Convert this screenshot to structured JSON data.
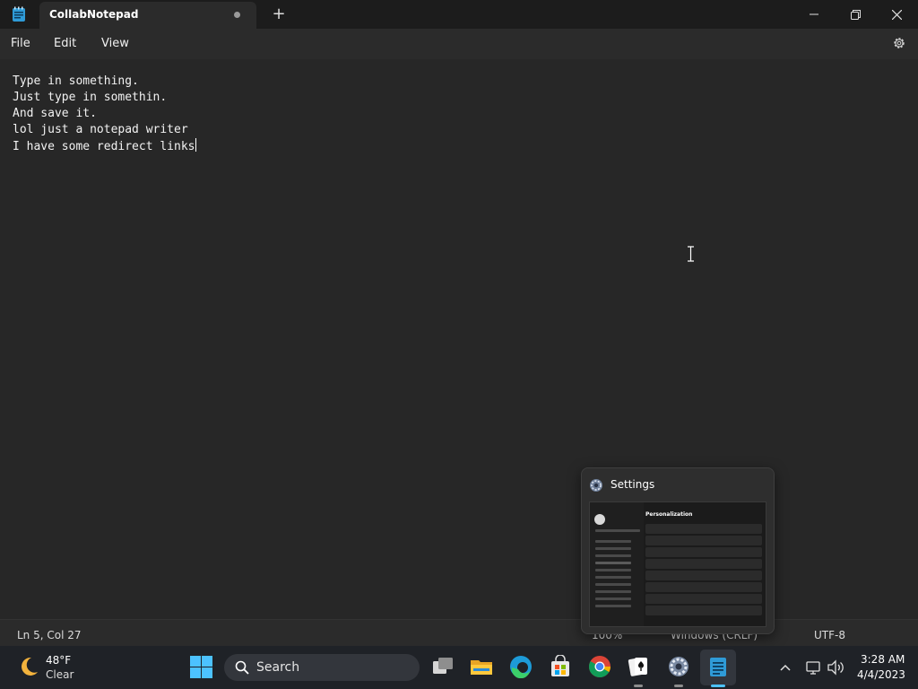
{
  "window": {
    "tab_title": "CollabNotepad",
    "new_tab_symbol": "+"
  },
  "menu": {
    "file": "File",
    "edit": "Edit",
    "view": "View"
  },
  "editor": {
    "lines": [
      "Type in something.",
      "Just type in somethin.",
      "And save it.",
      "lol just a notepad writer",
      "I have some redirect links"
    ]
  },
  "status": {
    "position": "Ln 5, Col 27",
    "zoom": "100%",
    "line_ending": "Windows (CRLF)",
    "encoding": "UTF-8"
  },
  "preview": {
    "title": "Settings",
    "page_heading": "Personalization"
  },
  "taskbar": {
    "weather_temp": "48°F",
    "weather_condition": "Clear",
    "search_label": "Search",
    "time": "3:28 AM",
    "date": "4/4/2023"
  },
  "colors": {
    "accent": "#4cc2ff",
    "background": "#272727"
  }
}
